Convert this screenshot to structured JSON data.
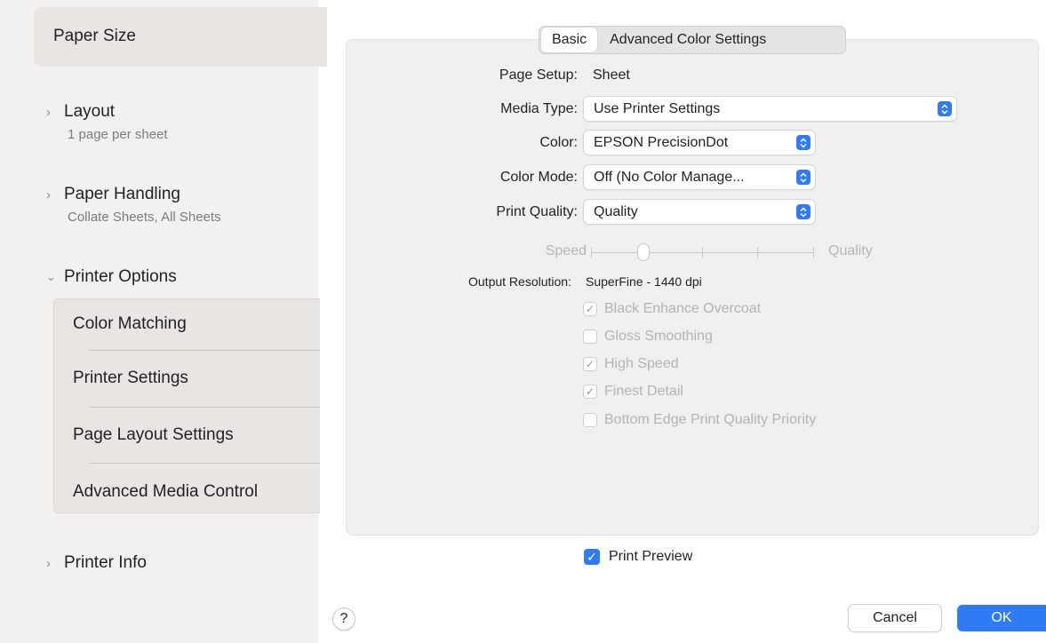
{
  "sidebar": {
    "selected_item": "Paper Size",
    "sections": [
      {
        "title": "Layout",
        "subtitle": "1 page per sheet",
        "expanded": false
      },
      {
        "title": "Paper Handling",
        "subtitle": "Collate Sheets, All Sheets",
        "expanded": false
      },
      {
        "title": "Printer Options",
        "expanded": true
      },
      {
        "title": "Printer Info",
        "expanded": false
      }
    ],
    "printer_options_items": [
      "Color Matching",
      "Printer Settings",
      "Page Layout Settings",
      "Advanced Media Control"
    ]
  },
  "tabs": [
    "Basic",
    "Advanced Color Settings"
  ],
  "active_tab": "Basic",
  "settings": {
    "page_setup_label": "Page Setup:",
    "page_setup_value": "Sheet",
    "media_type_label": "Media Type:",
    "media_type_value": "Use Printer Settings",
    "color_label": "Color:",
    "color_value": "EPSON PrecisionDot",
    "color_mode_label": "Color Mode:",
    "color_mode_value": "Off (No Color Manage...",
    "print_quality_label": "Print Quality:",
    "print_quality_value": "Quality"
  },
  "slider": {
    "left_label": "Speed",
    "right_label": "Quality",
    "position_step": 1,
    "steps": 5
  },
  "output_resolution": {
    "label": "Output Resolution:",
    "value": "SuperFine - 1440 dpi"
  },
  "options": [
    {
      "label": "Black Enhance Overcoat",
      "checked": true
    },
    {
      "label": "Gloss Smoothing",
      "checked": false
    },
    {
      "label": "High Speed",
      "checked": true
    },
    {
      "label": "Finest Detail",
      "checked": true
    },
    {
      "label": "Bottom Edge Print Quality Priority",
      "checked": false
    }
  ],
  "print_preview": {
    "label": "Print Preview",
    "checked": true
  },
  "buttons": {
    "help": "?",
    "cancel": "Cancel",
    "ok": "OK"
  },
  "colors": {
    "accent": "#2d7cf6",
    "sidebar_bg": "#f3f1ef",
    "panel_bg": "#f0f0f0"
  }
}
